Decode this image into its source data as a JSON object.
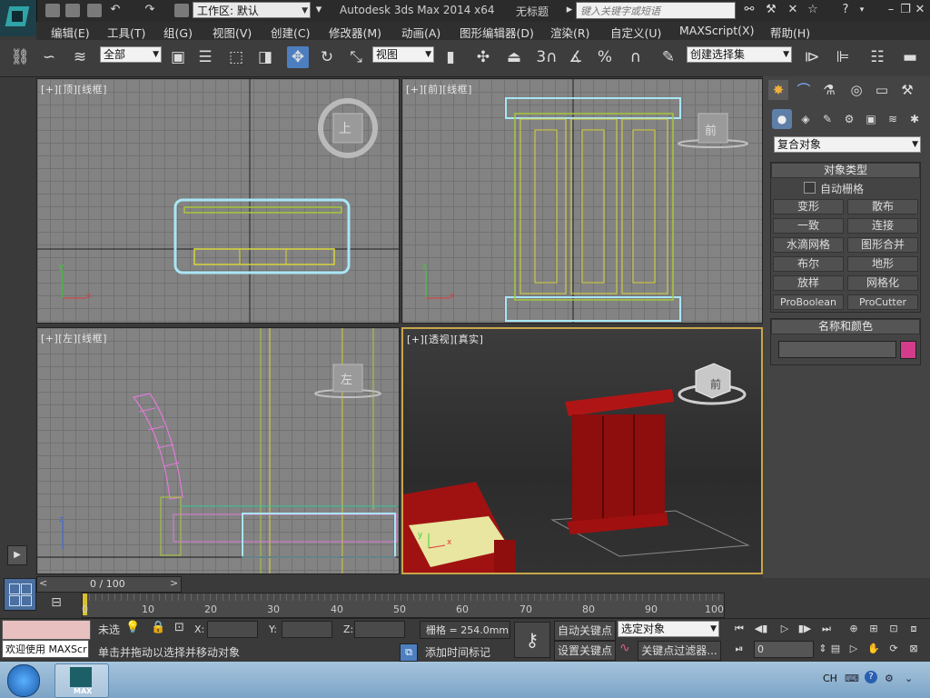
{
  "titlebar": {
    "workspace_label": "工作区: 默认",
    "app_title": "Autodesk 3ds Max  2014 x64",
    "doc_title": "无标题",
    "search_placeholder": "键入关键字或短语"
  },
  "menu": [
    "编辑(E)",
    "工具(T)",
    "组(G)",
    "视图(V)",
    "创建(C)",
    "修改器(M)",
    "动画(A)",
    "图形编辑器(D)",
    "渲染(R)",
    "自定义(U)",
    "MAXScript(X)",
    "帮助(H)"
  ],
  "toolbar": {
    "selection_filter": "全部",
    "ref_coord": "视图",
    "named_selection": "创建选择集",
    "snap_3": "3",
    "percent": "%"
  },
  "viewports": {
    "top_label": "[+][顶][线框]",
    "front_label": "[+][前][线框]",
    "left_label": "[+][左][线框]",
    "persp_label": "[+][透视][真实]",
    "top_cube": "上",
    "front_cube": "前",
    "left_cube": "左",
    "persp_cube": "前",
    "axis_x": "x",
    "axis_y": "y",
    "axis_z": "z"
  },
  "command_panel": {
    "category": "复合对象",
    "object_type_header": "对象类型",
    "auto_grid_label": "自动栅格",
    "auto_grid_checked": false,
    "buttons": [
      "变形",
      "散布",
      "一致",
      "连接",
      "水滴网格",
      "图形合并",
      "布尔",
      "地形",
      "放样",
      "网格化",
      "ProBoolean",
      "ProCutter"
    ],
    "name_color_header": "名称和颜色",
    "object_name": "",
    "object_color": "#d23c8a"
  },
  "timeline": {
    "frame_display": "0 / 100",
    "ticks": [
      "10",
      "20",
      "30",
      "40",
      "50",
      "60",
      "70",
      "80",
      "90",
      "100"
    ],
    "frame_start": "0"
  },
  "status": {
    "welcome_text": "欢迎使用 MAXScr",
    "selection_state": "未选",
    "x_label": "X:",
    "y_label": "Y:",
    "z_label": "Z:",
    "grid_text": "栅格 = 254.0mm",
    "prompt_text": "单击并拖动以选择并移动对象",
    "add_time_tag": "添加时间标记",
    "auto_key": "自动关键点",
    "set_key": "设置关键点",
    "key_mode_select": "选定对象",
    "key_filters": "关键点过滤器...",
    "current_frame": "0"
  },
  "taskbar": {
    "max_label": "MAX",
    "lang": "CH"
  },
  "colors": {
    "furniture_red": "#8e0d0d",
    "selection_cyan": "#a8e6f5",
    "wire_green": "#a8c83a",
    "wire_pink": "#e07ad8"
  }
}
